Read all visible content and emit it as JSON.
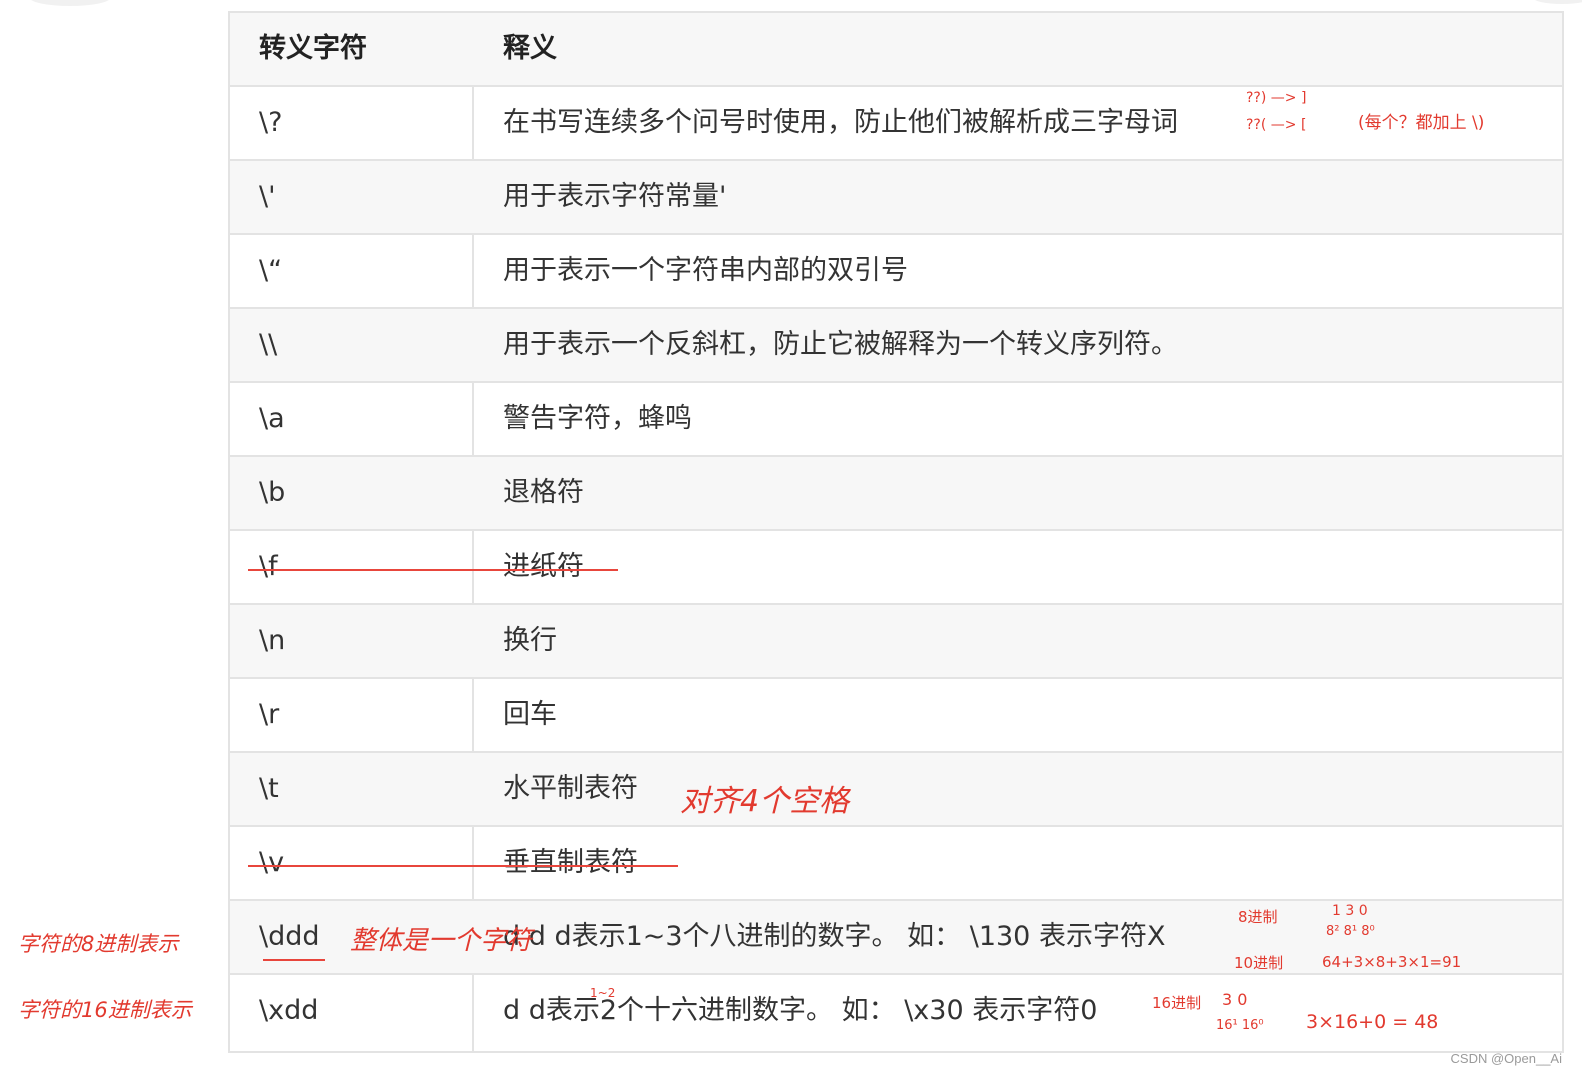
{
  "table": {
    "header": {
      "col1": "转义字符",
      "col2": "释义"
    },
    "rows": [
      {
        "escape": "\\?",
        "meaning": "在书写连续多个问号时使用，防止他们被解析成三字母词"
      },
      {
        "escape": "\\'",
        "meaning": "用于表示字符常量'"
      },
      {
        "escape": "\\“",
        "meaning": "用于表示一个字符串内部的双引号"
      },
      {
        "escape": "\\\\",
        "meaning": "用于表示一个反斜杠，防止它被解释为一个转义序列符。"
      },
      {
        "escape": "\\a",
        "meaning": "警告字符，蜂鸣"
      },
      {
        "escape": "\\b",
        "meaning": "退格符"
      },
      {
        "escape": "\\f",
        "meaning": "进纸符"
      },
      {
        "escape": "\\n",
        "meaning": "换行"
      },
      {
        "escape": "\\r",
        "meaning": "回车"
      },
      {
        "escape": "\\t",
        "meaning": "水平制表符"
      },
      {
        "escape": "\\v",
        "meaning": "垂直制表符"
      },
      {
        "escape": "\\ddd",
        "meaning": "d d d表示1~3个八进制的数字。 如： \\130 表示字符X"
      },
      {
        "escape": "\\xdd",
        "meaning": "d d表示2个十六进制数字。 如： \\x30 表示字符0"
      }
    ]
  },
  "annotations": {
    "trigraph_1": "??) —> ]",
    "trigraph_2": "??( —> [",
    "trigraph_note": "(每个？都加上 \\)",
    "tab_note": "对齐4个空格",
    "octal_left": "字符的8进制表示",
    "hex_left": "字符的16进制表示",
    "ddd_note": "整体是一个字符",
    "octal_label": "8进制",
    "decimal_label_1": "10进制",
    "octal_digits": "1 3 0",
    "octal_powers": "8² 8¹ 8⁰",
    "octal_calc": "64+3×8+3×1=91",
    "hex_label": "16进制",
    "hex_digits": "3 0",
    "hex_powers": "16¹ 16⁰",
    "hex_calc": "3×16+0 = 48",
    "hex_small": "1~2"
  },
  "watermark": "CSDN @Open__Ai",
  "colors": {
    "ink": "#e23a2f",
    "border": "#e3e3e3",
    "stripe": "#f7f7f7"
  }
}
